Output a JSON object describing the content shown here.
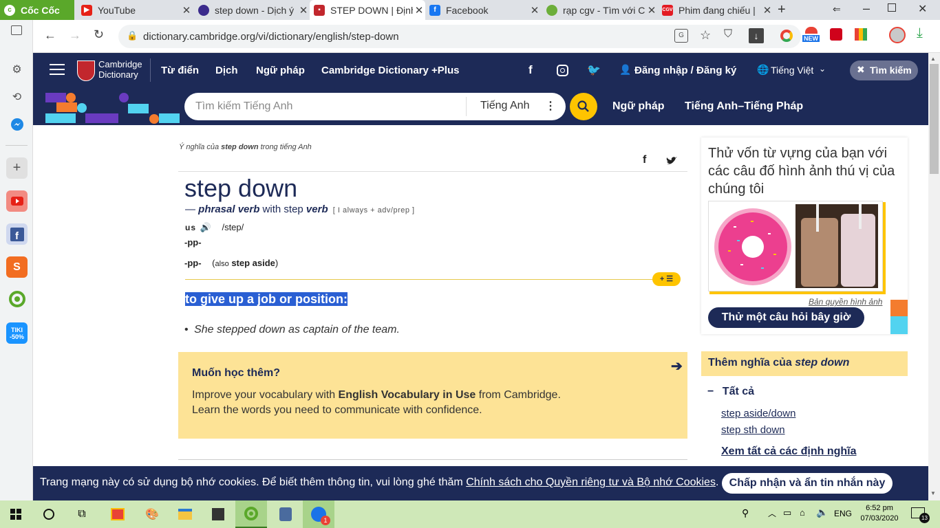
{
  "browser": {
    "tabs": [
      {
        "label": "Cốc Cốc",
        "color": "#5aa82a"
      },
      {
        "label": "YouTube",
        "color": "#e62117"
      },
      {
        "label": "step down - Dịch ý",
        "color": "#3b2b8c"
      },
      {
        "label": "STEP DOWN | Định",
        "color": "#c2272d"
      },
      {
        "label": "Facebook",
        "color": "#1877f2"
      },
      {
        "label": "rạp cgv - Tìm với C",
        "color": "#6cae3a"
      },
      {
        "label": "Phim đang chiếu |",
        "color": "#e31b23"
      }
    ],
    "url": "dictionary.cambridge.org/vi/dictionary/english/step-down",
    "new_badge": "NEW"
  },
  "cambridge": {
    "logo_line1": "Cambridge",
    "logo_line2": "Dictionary",
    "nav": [
      "Từ điển",
      "Dịch",
      "Ngữ pháp",
      "Cambridge Dictionary +Plus"
    ],
    "login": "Đăng nhập / Đăng ký",
    "language": "Tiếng Việt",
    "search_button": "Tìm kiếm",
    "search_placeholder": "Tìm kiếm Tiếng Anh",
    "search_lang": "Tiếng Anh",
    "grammar_link": "Ngữ pháp",
    "en_fr_link": "Tiếng Anh–Tiếng Pháp"
  },
  "entry": {
    "breadcrumb_prefix": "Ý nghĩa của ",
    "breadcrumb_word": "step down",
    "breadcrumb_suffix": " trong tiếng Anh",
    "headword": "step down",
    "pos_dash": "— ",
    "pos": "phrasal verb",
    "pos_with": " with step ",
    "pos_verb": "verb",
    "grammar": "[ I always + adv/prep ]",
    "us_label": "us",
    "pron": "/step/",
    "inflect1": "-pp-",
    "inflect2": "-pp-",
    "also_open": "(",
    "also_word": "also",
    "also_term": "step aside",
    "also_close": ")",
    "definition": "to give up a job or position:",
    "example": "She stepped down as captain of the team.",
    "bullet": "•"
  },
  "learn_more": {
    "title": "Muốn học thêm?",
    "line1_pre": "Improve your vocabulary with ",
    "line1_bold": "English Vocabulary in Use",
    "line1_post": " from Cambridge.",
    "line2": "Learn the words you need to communicate with confidence."
  },
  "quiz": {
    "title": "Thử vốn từ vựng của bạn với các câu đố hình ảnh thú vị của chúng tôi",
    "copyright": "Bản quyền hình ảnh",
    "button": "Thử một câu hỏi bây giờ"
  },
  "more_meanings": {
    "title_pre": "Thêm nghĩa của ",
    "title_word": "step down",
    "all": "Tất cả",
    "links": [
      "step aside/down",
      "step sth down"
    ],
    "see_all": "Xem tất cả các định nghĩa"
  },
  "cookie": {
    "text": "Trang mạng này có sử dụng bộ nhớ cookies. Để biết thêm thông tin, vui lòng ghé thăm ",
    "link": "Chính sách cho Quyền riêng tư và Bộ nhớ Cookies",
    "end": ".",
    "button": "Chấp nhận và ẩn tin nhắn này"
  },
  "taskbar": {
    "language": "ENG",
    "time": "6:52 pm",
    "date": "07/03/2020",
    "notif_count": "13",
    "zalo_badge": "1"
  },
  "sidebar": {
    "tiki_line1": "TIKI",
    "tiki_line2": "-50%"
  }
}
